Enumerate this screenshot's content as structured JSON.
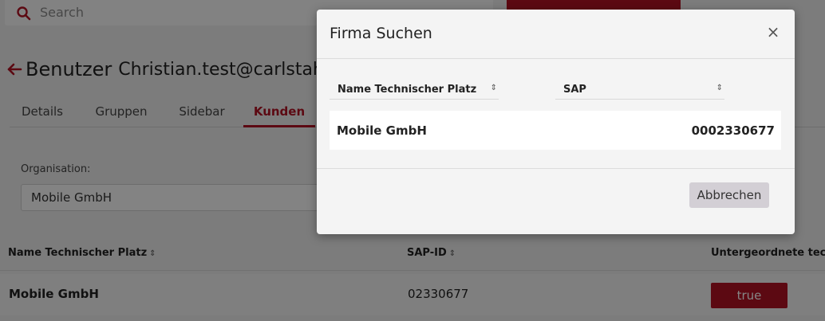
{
  "header": {
    "search_placeholder": "Search"
  },
  "page": {
    "title": "Benutzer",
    "user": "Christian.test@carlstah"
  },
  "tabs": [
    {
      "label": "Details"
    },
    {
      "label": "Gruppen"
    },
    {
      "label": "Sidebar"
    },
    {
      "label": "Kunden",
      "active": true
    }
  ],
  "organisation": {
    "label": "Organisation:",
    "value": "Mobile GmbH"
  },
  "table": {
    "columns": [
      "Name Technischer Platz",
      "SAP-ID",
      "Untergeordnete techn"
    ],
    "rows": [
      {
        "name": "Mobile GmbH",
        "sap_id": "02330677",
        "badge": "true"
      }
    ]
  },
  "modal": {
    "title": "Firma Suchen",
    "close_symbol": "×",
    "columns": [
      "Name Technischer Platz",
      "SAP"
    ],
    "rows": [
      {
        "name": "Mobile GmbH",
        "sap": "0002330677"
      }
    ],
    "cancel_label": "Abbrechen"
  },
  "icons": {
    "sort": "⇕",
    "search": "search-icon",
    "back": "arrow-left-icon"
  },
  "colors": {
    "accent": "#b01323",
    "background": "#ededed",
    "modal_background": "#f4f4f4",
    "cancel_button": "#d3cfd5"
  }
}
